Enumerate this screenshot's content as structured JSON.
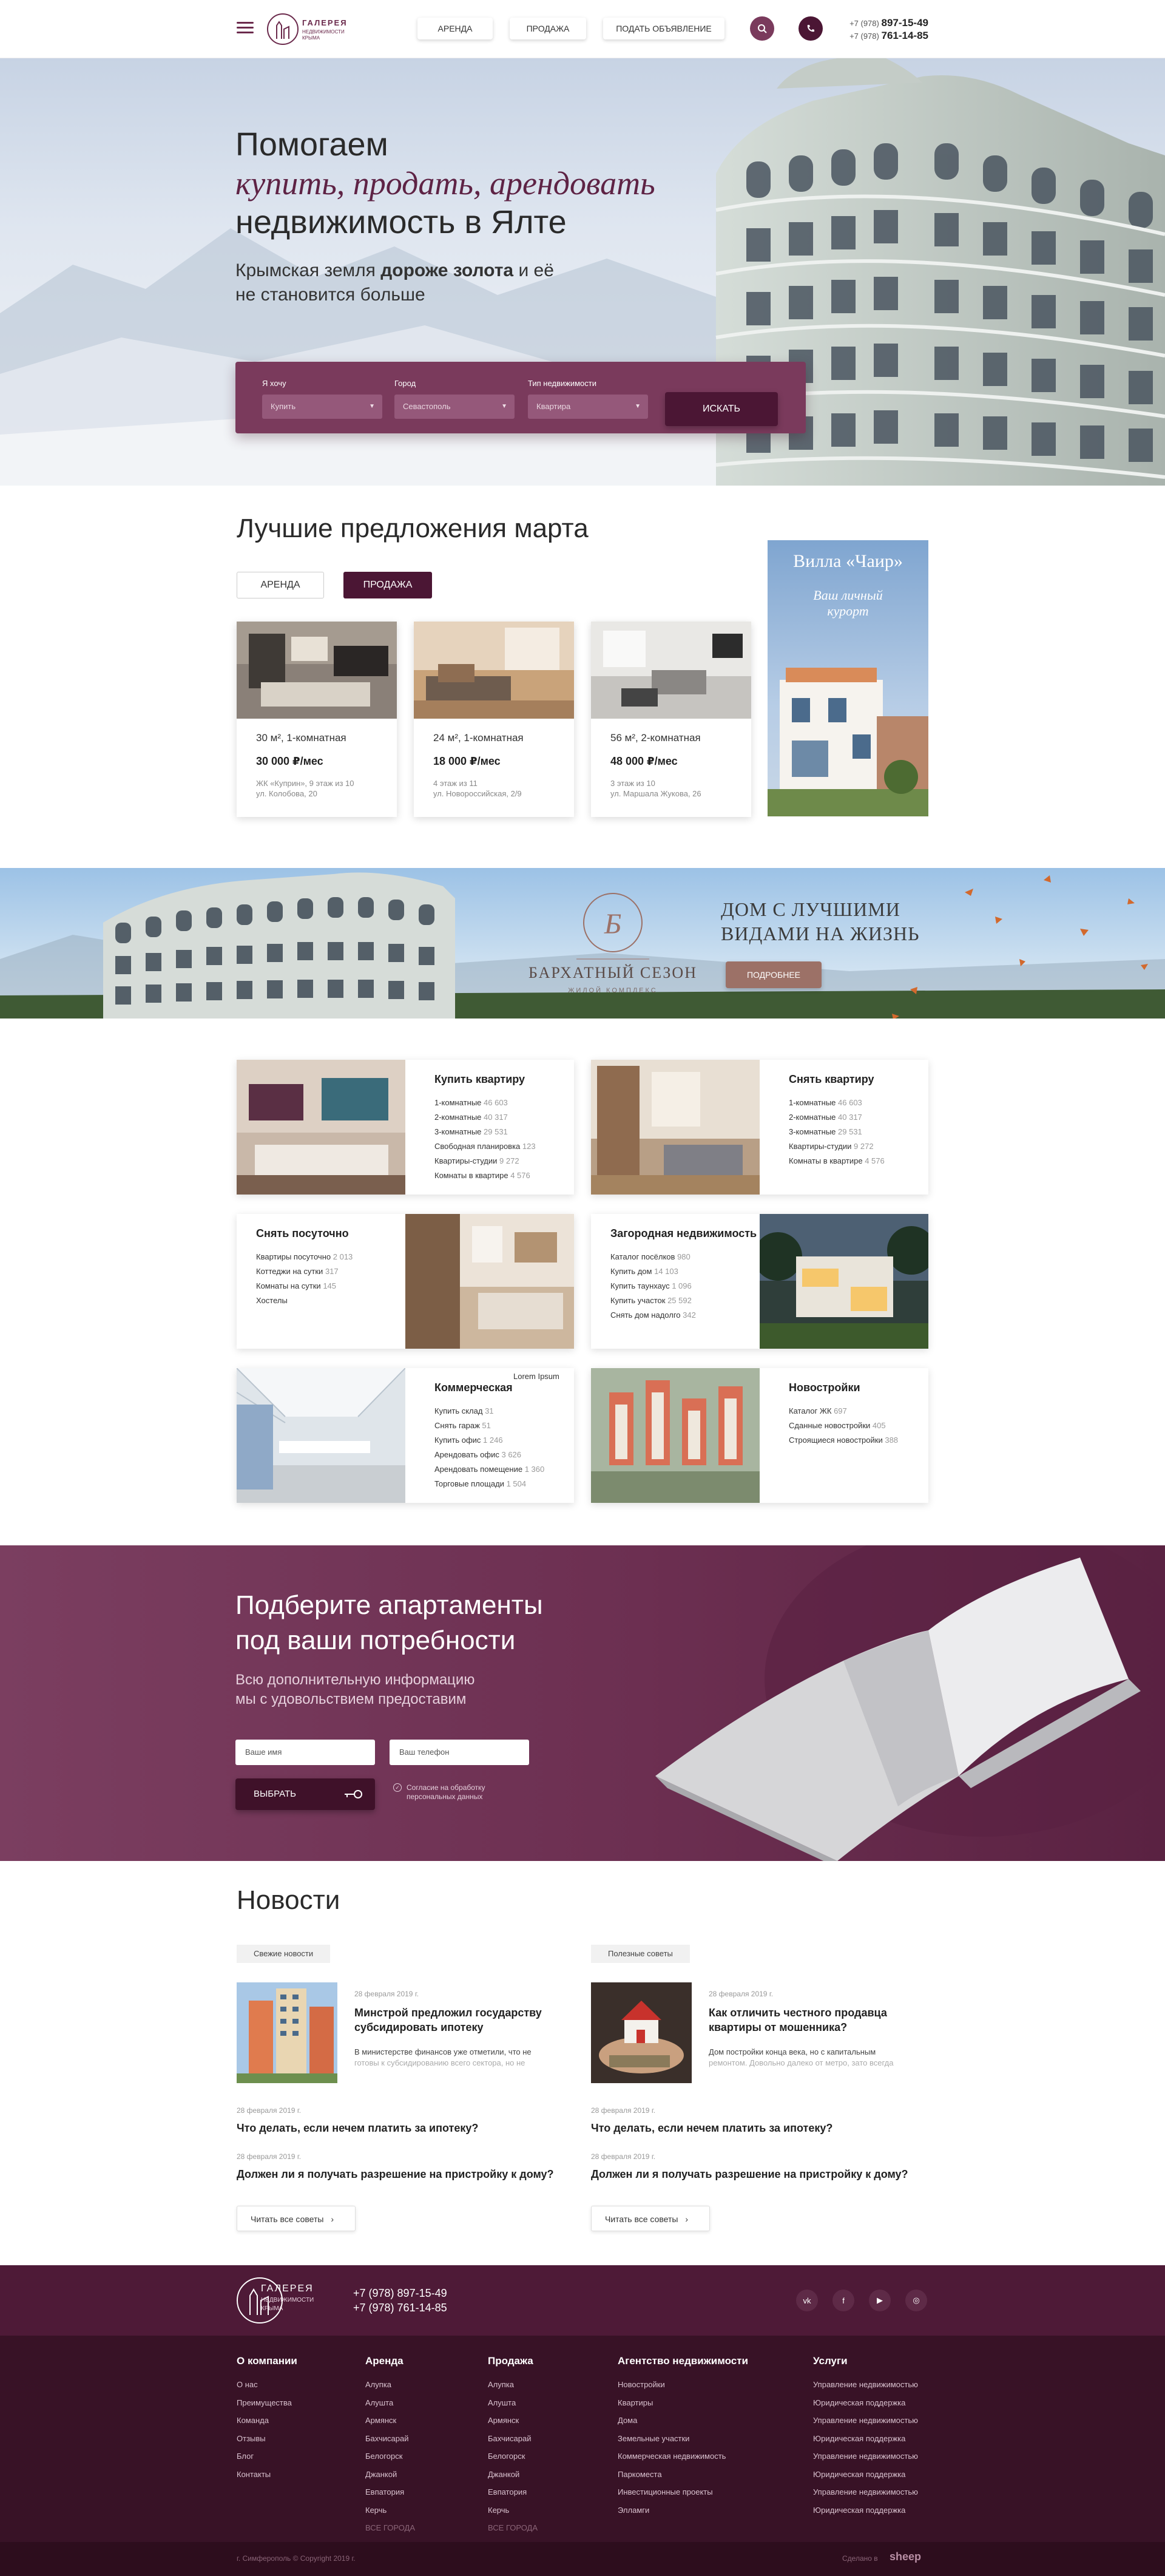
{
  "header": {
    "logo": {
      "line1": "ГАЛЕРЕЯ",
      "line2": "НЕДВИЖИМОСТИ КРЫМА"
    },
    "nav": [
      "АРЕНДА",
      "ПРОДАЖА",
      "ПОДАТЬ ОБЪЯВЛЕНИЕ"
    ],
    "phone1_prefix": "+7 (978)",
    "phone1": "897-15-49",
    "phone2_prefix": "+7 (978)",
    "phone2": "761-14-85"
  },
  "hero": {
    "line1": "Помогаем",
    "line2": "купить, продать, арендовать",
    "line3": "недвижимость в Ялте",
    "sub_a": "Крымская земля ",
    "sub_b": "дороже золота",
    "sub_c": " и её",
    "sub_d": "не становится больше",
    "search": {
      "want_label": "Я хочу",
      "want_value": "Купить",
      "city_label": "Город",
      "city_value": "Севастополь",
      "type_label": "Тип недвижимости",
      "type_value": "Квартира",
      "button": "ИСКАТЬ"
    }
  },
  "offers": {
    "title": "Лучшие предложения марта",
    "tabs": [
      "АРЕНДА",
      "ПРОДАЖА"
    ],
    "cards": [
      {
        "title": "30 м², 1-комнатная",
        "price": "30 000 ₽/мес",
        "addr1": "ЖК «Куприн», 9 этаж из 10",
        "addr2": "ул. Колобова, 20"
      },
      {
        "title": "24 м², 1-комнатная",
        "price": "18 000 ₽/мес",
        "addr1": "4 этаж из 11",
        "addr2": "ул. Новороссийская, 2/9"
      },
      {
        "title": "56 м², 2-комнатная",
        "price": "48 000 ₽/мес",
        "addr1": "3 этаж из 10",
        "addr2": "ул. Маршала Жукова, 26"
      }
    ],
    "promo": {
      "title": "Вилла «Чаир»",
      "sub1": "Ваш личный",
      "sub2": "курорт"
    }
  },
  "banner": {
    "brand": "БАРХАТНЫЙ СЕЗОН",
    "brand_sub": "ЖИЛОЙ КОМПЛЕКС",
    "heading1": "ДОМ С ЛУЧШИМИ",
    "heading2": "ВИДАМИ НА ЖИЗНЬ",
    "button": "ПОДРОБНЕЕ"
  },
  "categories": [
    {
      "title": "Купить квартиру",
      "rows": [
        [
          "1-комнатные",
          "46 603"
        ],
        [
          "2-комнатные",
          "40 317"
        ],
        [
          "3-комнатные",
          "29 531"
        ],
        [
          "Свободная планировка",
          "123"
        ],
        [
          "Квартиры-студии",
          "9 272"
        ],
        [
          "Комнаты в квартире",
          "4 576"
        ]
      ]
    },
    {
      "title": "Снять квартиру",
      "rows": [
        [
          "1-комнатные",
          "46 603"
        ],
        [
          "2-комнатные",
          "40 317"
        ],
        [
          "3-комнатные",
          "29 531"
        ],
        [
          "Квартиры-студии",
          "9 272"
        ],
        [
          "Комнаты в квартире",
          "4 576"
        ]
      ]
    },
    {
      "title": "Снять посуточно",
      "rows": [
        [
          "Квартиры посуточно",
          "2 013"
        ],
        [
          "Коттеджи на сутки",
          "317"
        ],
        [
          "Комнаты на сутки",
          "145"
        ],
        [
          "Хостелы",
          ""
        ]
      ]
    },
    {
      "title": "Загородная недвижимость",
      "rows": [
        [
          "Каталог посёлков",
          "980"
        ],
        [
          "Купить дом",
          "14 103"
        ],
        [
          "Купить таунхаус",
          "1 096"
        ],
        [
          "Купить участок",
          "25 592"
        ],
        [
          "Снять дом надолго",
          "342"
        ]
      ]
    },
    {
      "title": "Коммерческая",
      "corner": "Lorem Ipsum",
      "rows": [
        [
          "Купить склад",
          "31"
        ],
        [
          "Снять гараж",
          "51"
        ],
        [
          "Купить офис",
          "1 246"
        ],
        [
          "Арендовать офис",
          "3 626"
        ],
        [
          "Арендовать помещение",
          "1 360"
        ],
        [
          "Торговые площади",
          "1 504"
        ]
      ]
    },
    {
      "title": "Новостройки",
      "rows": [
        [
          "Каталог ЖК",
          "697"
        ],
        [
          "Сданные новостройки",
          "405"
        ],
        [
          "Строящиеся новостройки",
          "388"
        ]
      ]
    }
  ],
  "apartments": {
    "title1": "Подберите апартаменты",
    "title2": "под ваши потребности",
    "sub1": "Всю дополнительную информацию",
    "sub2": "мы с удовольствием предоставим",
    "name_placeholder": "Ваше имя",
    "phone_placeholder": "Ваш телефон",
    "button": "ВЫБРАТЬ",
    "consent1": "Согласие на обработку",
    "consent2": "персональных данных"
  },
  "news": {
    "title": "Новости",
    "left": {
      "tag": "Свежие новости",
      "date": "28 февраля 2019 г.",
      "title1": "Минстрой предложил государству",
      "title2": "субсидировать ипотеку",
      "text1": "В министерстве финансов уже отметили, что не",
      "text2": "готовы к субсидированию всего сектора, но не",
      "item1_date": "28 февраля 2019 г.",
      "item1": "Что делать, если нечем платить за ипотеку?",
      "item2_date": "28 февраля 2019 г.",
      "item2": "Должен ли я получать разрешение на пристройку к дому?",
      "readall": "Читать все советы"
    },
    "right": {
      "tag": "Полезные советы",
      "date": "28 февраля 2019 г.",
      "title1": "Как отличить честного продавца",
      "title2": "квартиры от мошенника?",
      "text1": "Дом постройки конца века, но с капитальным",
      "text2": "ремонтом. Довольно далеко от метро, зато всегда",
      "item1_date": "28 февраля 2019 г.",
      "item1": "Что делать, если нечем платить за ипотеку?",
      "item2_date": "28 февраля 2019 г.",
      "item2": "Должен ли я получать разрешение на пристройку к дому?",
      "readall": "Читать все советы"
    }
  },
  "footer": {
    "logo1": "ГАЛЕРЕЯ",
    "logo2": "НЕДВИЖИМОСТИ",
    "logo3": "КРЫМА",
    "phone1": "+7 (978) 897-15-49",
    "phone2": "+7 (978) 761-14-85",
    "social": [
      "vk",
      "f",
      "▶",
      "◎"
    ],
    "cols": [
      {
        "title": "О компании",
        "items": [
          "О нас",
          "Преимущества",
          "Команда",
          "Отзывы",
          "Блог",
          "Контакты"
        ]
      },
      {
        "title": "Аренда",
        "items": [
          "Алупка",
          "Алушта",
          "Армянск",
          "Бахчисарай",
          "Белогорск",
          "Джанкой",
          "Евпатория",
          "Керчь"
        ],
        "more": "ВСЕ ГОРОДА"
      },
      {
        "title": "Продажа",
        "items": [
          "Алупка",
          "Алушта",
          "Армянск",
          "Бахчисарай",
          "Белогорск",
          "Джанкой",
          "Евпатория",
          "Керчь"
        ],
        "more": "ВСЕ ГОРОДА"
      },
      {
        "title": "Агентство недвижимости",
        "items": [
          "Новостройки",
          "Квартиры",
          "Дома",
          "Земельные участки",
          "Коммерческая недвижимость",
          "Паркоместа",
          "Инвестиционные проекты",
          "Элламги"
        ]
      },
      {
        "title": "Услуги",
        "items": [
          "Управление недвижимостью",
          "Юридическая поддержка",
          "Управление недвижимостью",
          "Юридическая поддержка",
          "Управление недвижимостью",
          "Юридическая поддержка",
          "Управление недвижимостью",
          "Юридическая поддержка"
        ]
      }
    ],
    "copyright": "г. Симферополь © Copyright 2019 г.",
    "made": "Сделано в",
    "studio": "sheep"
  },
  "colors": {
    "primary": "#6b2a4c",
    "dark": "#4b1634",
    "footer": "#381226"
  }
}
